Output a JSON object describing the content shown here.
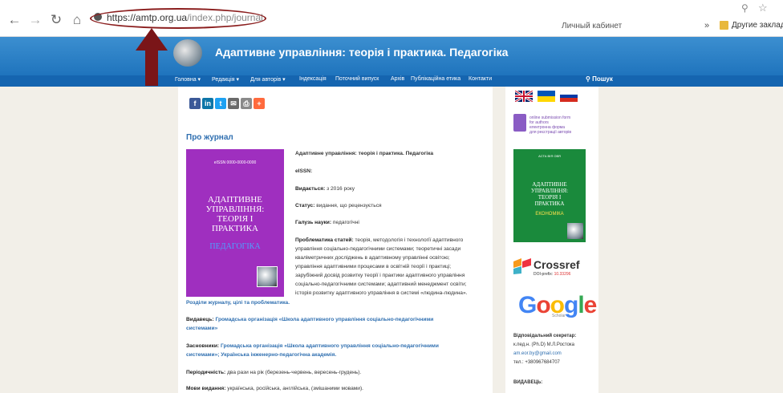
{
  "browser": {
    "url_prefix": "https://",
    "url_domain": "amtp.org.ua",
    "url_path": "/index.php/journal",
    "cabinet": "Личный кабинет",
    "bookmarks_chevron": "»",
    "other_bookmarks": "Другие закладк"
  },
  "site": {
    "title": "Адаптивне управління: теорія і практика. Педагогіка",
    "menu": [
      "Головна ▾",
      "Редакція ▾",
      "Для авторів ▾",
      "Індексація",
      "Поточний випуск",
      "Архів",
      "Публікаційна етика",
      "Контакти"
    ],
    "search_label": "Пошук"
  },
  "share_icons": [
    "f",
    "in",
    "t",
    "✉",
    "⎙",
    "+"
  ],
  "main": {
    "about_title": "Про журнал",
    "cover": {
      "issn": "eISSN 0000-0000-0000",
      "title_lines": [
        "АДАПТИВНЕ",
        "УПРАВЛІННЯ:",
        "ТЕОРІЯ І",
        "ПРАКТИКА"
      ],
      "subtitle": "ПЕДАГОГІКА"
    },
    "journal_name": "Адаптивне управління: теорія і практика. Педагогіка",
    "eissn_label": "eISSN:",
    "published_label": "Видається:",
    "published_value": "з 2016 року",
    "status_label": "Статус:",
    "status_value": "видання, що рецензується",
    "field_label": "Галузь науки:",
    "field_value": "педагогічні",
    "problems_label": "Проблематика статей:",
    "problems_lines": [
      "теорія, методологія і технології адаптивного",
      "управління соціально-педагогічними системами; теоретичні засади",
      "кваліметричних досліджень в адаптивному управлінні освітою;",
      "управління адаптивними процесами в освітній теорії і практиці;",
      "зарубіжний досвід розвитку теорії і практики адаптивного управління",
      "соціально-педагогічними системами; адаптивний менеджмент освіти;",
      "історія розвитку адаптивного управління в системі «людина-людина»."
    ],
    "sections_link": "Розділи журналу, цілі та проблематика.",
    "publisher_label": "Видавець:",
    "publisher_lines": [
      "Громадська організація «Школа адаптивного управління соціально-педагогічними",
      "системами»"
    ],
    "founders_label": "Засновники:",
    "founders_lines": [
      "Громадська організація «Школа адаптивного управління соціально-педагогічними",
      "системами»; Українська інженерно-педагогічна академія."
    ],
    "periodicity_label": "Періодичність:",
    "periodicity_value": "два рази на рік (березень-червень, вересень-грудень).",
    "languages_label": "Мови видання:",
    "languages_value": "українська, російська, англійська, (змішаними мовами)."
  },
  "sidebar": {
    "submission_lines": [
      "online submission form",
      "for authors",
      "електронна форма",
      "для реєстрації авторів"
    ],
    "cover2": {
      "header": "АСТА ВІЯ ОВЯ",
      "title_lines": [
        "АДАПТИВНЕ",
        "УПРАВЛІННЯ:",
        "ТЕОРІЯ І",
        "ПРАКТИКА"
      ],
      "subtitle": "ЕКОНОМІКА"
    },
    "crossref": "Crossref",
    "doi_prefix_label": "DOI-prefix:",
    "doi_prefix_value": "10.33296",
    "google": "Google",
    "scholar": "Scholar",
    "secretary_label": "Відповідальний секретар:",
    "secretary_name": "к.пед.н. (Ph.D) М.Л.Ростока",
    "secretary_email": "am.eor.by@gmail.com",
    "secretary_phone": "тел.: +380967684707",
    "publisher_label": "ВИДАВЕЦЬ:"
  },
  "colors": {
    "header_blue": "#1f74bd",
    "arrow": "#7a1518",
    "cover_purple": "#9f2fbf",
    "cover_green": "#1a8a3c"
  }
}
